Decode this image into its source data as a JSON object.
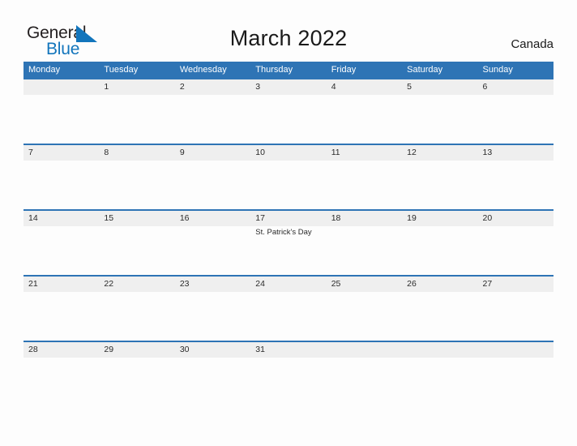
{
  "brand": {
    "name_line1": "General",
    "name_line2": "Blue",
    "flag_icon": "blue-triangle-flag-icon",
    "color_dark": "#231f20",
    "color_blue": "#1275bc"
  },
  "header": {
    "title": "March 2022",
    "country": "Canada"
  },
  "theme": {
    "header_blue": "#2e74b5",
    "band_gray": "#efefef",
    "page_background": "#fdfdfd",
    "text_dark": "#2a2a2a"
  },
  "calendar": {
    "month": "March",
    "year": "2022",
    "weekday_headers": [
      "Monday",
      "Tuesday",
      "Wednesday",
      "Thursday",
      "Friday",
      "Saturday",
      "Sunday"
    ],
    "weeks": [
      {
        "days": [
          {
            "num": "",
            "event": ""
          },
          {
            "num": "1",
            "event": ""
          },
          {
            "num": "2",
            "event": ""
          },
          {
            "num": "3",
            "event": ""
          },
          {
            "num": "4",
            "event": ""
          },
          {
            "num": "5",
            "event": ""
          },
          {
            "num": "6",
            "event": ""
          }
        ]
      },
      {
        "days": [
          {
            "num": "7",
            "event": ""
          },
          {
            "num": "8",
            "event": ""
          },
          {
            "num": "9",
            "event": ""
          },
          {
            "num": "10",
            "event": ""
          },
          {
            "num": "11",
            "event": ""
          },
          {
            "num": "12",
            "event": ""
          },
          {
            "num": "13",
            "event": ""
          }
        ]
      },
      {
        "days": [
          {
            "num": "14",
            "event": ""
          },
          {
            "num": "15",
            "event": ""
          },
          {
            "num": "16",
            "event": ""
          },
          {
            "num": "17",
            "event": "St. Patrick's Day"
          },
          {
            "num": "18",
            "event": ""
          },
          {
            "num": "19",
            "event": ""
          },
          {
            "num": "20",
            "event": ""
          }
        ]
      },
      {
        "days": [
          {
            "num": "21",
            "event": ""
          },
          {
            "num": "22",
            "event": ""
          },
          {
            "num": "23",
            "event": ""
          },
          {
            "num": "24",
            "event": ""
          },
          {
            "num": "25",
            "event": ""
          },
          {
            "num": "26",
            "event": ""
          },
          {
            "num": "27",
            "event": ""
          }
        ]
      },
      {
        "days": [
          {
            "num": "28",
            "event": ""
          },
          {
            "num": "29",
            "event": ""
          },
          {
            "num": "30",
            "event": ""
          },
          {
            "num": "31",
            "event": ""
          },
          {
            "num": "",
            "event": ""
          },
          {
            "num": "",
            "event": ""
          },
          {
            "num": "",
            "event": ""
          }
        ]
      }
    ]
  }
}
